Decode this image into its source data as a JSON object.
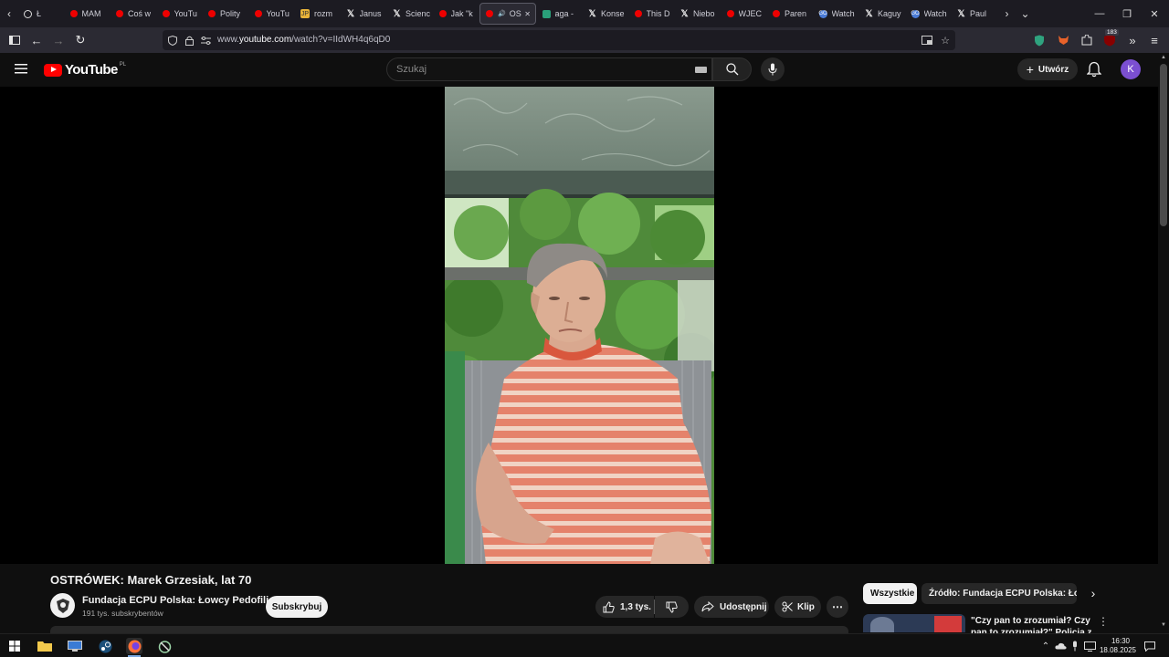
{
  "browser": {
    "tabs": [
      {
        "label": "Ł",
        "icon": "ring"
      },
      {
        "label": "MAM",
        "icon": "yt"
      },
      {
        "label": "Coś w",
        "icon": "yt"
      },
      {
        "label": "YouTu",
        "icon": "yt"
      },
      {
        "label": "Polity",
        "icon": "yt"
      },
      {
        "label": "YouTu",
        "icon": "yt"
      },
      {
        "label": "rozm",
        "icon": "jp"
      },
      {
        "label": "Janus",
        "icon": "x"
      },
      {
        "label": "Scienc",
        "icon": "x"
      },
      {
        "label": "Jak \"k",
        "icon": "yt"
      },
      {
        "label": "OS",
        "icon": "yt",
        "active": true
      },
      {
        "label": "aga -",
        "icon": "gr"
      },
      {
        "label": "Konse",
        "icon": "x"
      },
      {
        "label": "This D",
        "icon": "yt"
      },
      {
        "label": "Niebo",
        "icon": "x"
      },
      {
        "label": "WJEC",
        "icon": "yt"
      },
      {
        "label": "Paren",
        "icon": "yt"
      },
      {
        "label": "Watch",
        "icon": "go"
      },
      {
        "label": "Kaguy",
        "icon": "x"
      },
      {
        "label": "Watch",
        "icon": "go"
      },
      {
        "label": "Paul",
        "icon": "x"
      }
    ],
    "url_prefix": "www.",
    "url_domain": "youtube.com",
    "url_rest": "/watch?v=IIdWH4q6qD0",
    "extension_badge": "183"
  },
  "masthead": {
    "logo_text": "YouTube",
    "region": "PL",
    "search_placeholder": "Szukaj",
    "create_label": "Utwórz",
    "avatar_letter": "K"
  },
  "video": {
    "title": "OSTRÓWEK: Marek Grzesiak, lat 70",
    "channel": "Fundacja ECPU Polska: Łowcy Pedofili",
    "subscribers": "191 tys. subskrybentów",
    "subscribe_label": "Subskrybuj",
    "likes": "1,3 tys.",
    "share_label": "Udostępnij",
    "clip_label": "Klip"
  },
  "sidebar": {
    "chips": [
      "Wszystkie",
      "Źródło: Fundacja ECPU Polska: Łowcy"
    ],
    "rec_title": "\"Czy pan to zrozumiał? Czy pan to zrozumiał?\" Policja z okręg"
  },
  "taskbar": {
    "time": "16:30",
    "date": "18.08.2025"
  },
  "colors": {
    "yt_red": "#ff0000",
    "background": "#0f0f0f",
    "chip_active_bg": "#f1f1f1"
  }
}
